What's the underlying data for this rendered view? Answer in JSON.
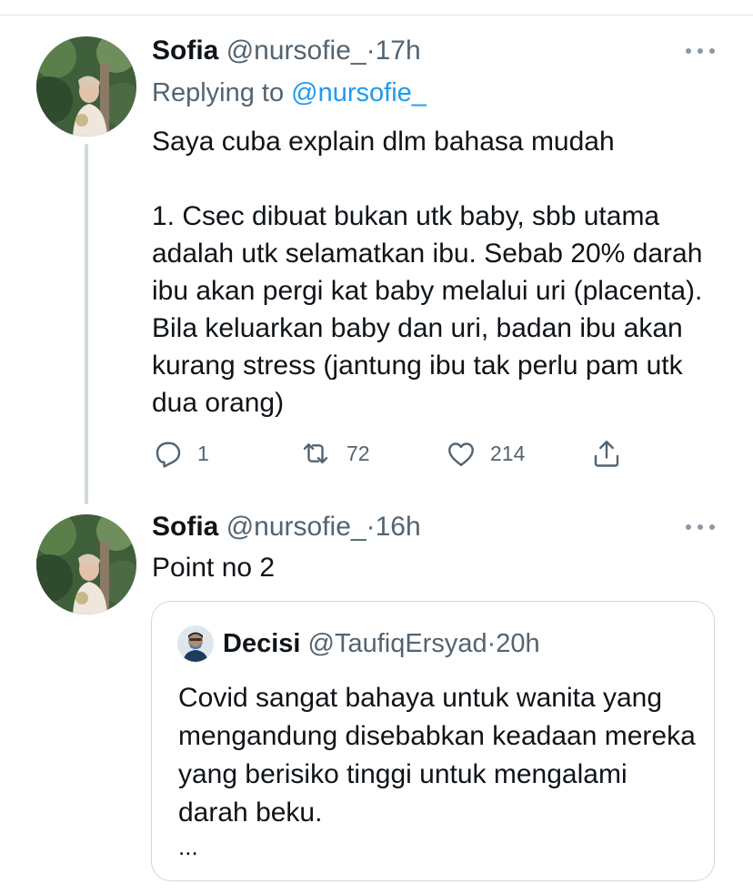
{
  "tweets": [
    {
      "name": "Sofia",
      "handle": "@nursofie_",
      "separator": "·",
      "time": "17h",
      "replying_prefix": "Replying to",
      "replying_to": "@nursofie_",
      "text": "Saya cuba explain dlm bahasa mudah\n\n1. Csec dibuat bukan utk baby, sbb utama adalah utk selamatkan ibu. Sebab 20% darah ibu akan pergi kat baby melalui uri (placenta). Bila keluarkan baby dan uri, badan ibu akan kurang stress (jantung ibu tak perlu pam utk dua orang)",
      "replies": "1",
      "retweets": "72",
      "likes": "214"
    },
    {
      "name": "Sofia",
      "handle": "@nursofie_",
      "separator": "·",
      "time": "16h",
      "text": "Point no 2"
    }
  ],
  "quoted_tweet": {
    "name": "Decisi",
    "handle": "@TaufiqErsyad",
    "separator": "·",
    "time": "20h",
    "text": "Covid sangat bahaya untuk wanita yang mengandung disebabkan keadaan mereka yang berisiko tinggi untuk mengalami darah beku.",
    "ellipsis": "..."
  },
  "icons": {
    "more": "more-icon",
    "reply": "reply-icon",
    "retweet": "retweet-icon",
    "like": "heart-icon",
    "share": "share-icon"
  },
  "colors": {
    "text": "#0f1419",
    "secondary": "#536471",
    "link": "#1d9bf0",
    "border": "#cfd9de"
  }
}
